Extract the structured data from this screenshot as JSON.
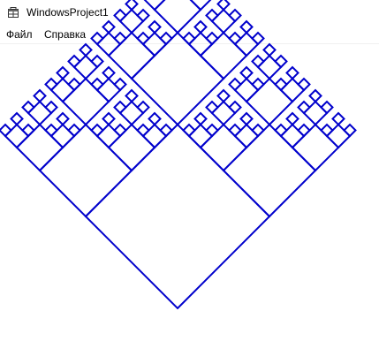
{
  "window": {
    "title": "WindowsProject1",
    "icon": "application-icon"
  },
  "menu": {
    "items": [
      {
        "label": "Файл"
      },
      {
        "label": "Справка"
      }
    ]
  },
  "fractal": {
    "type": "recursive-square-tree",
    "stroke_color": "#0000cc",
    "levels": 5
  }
}
